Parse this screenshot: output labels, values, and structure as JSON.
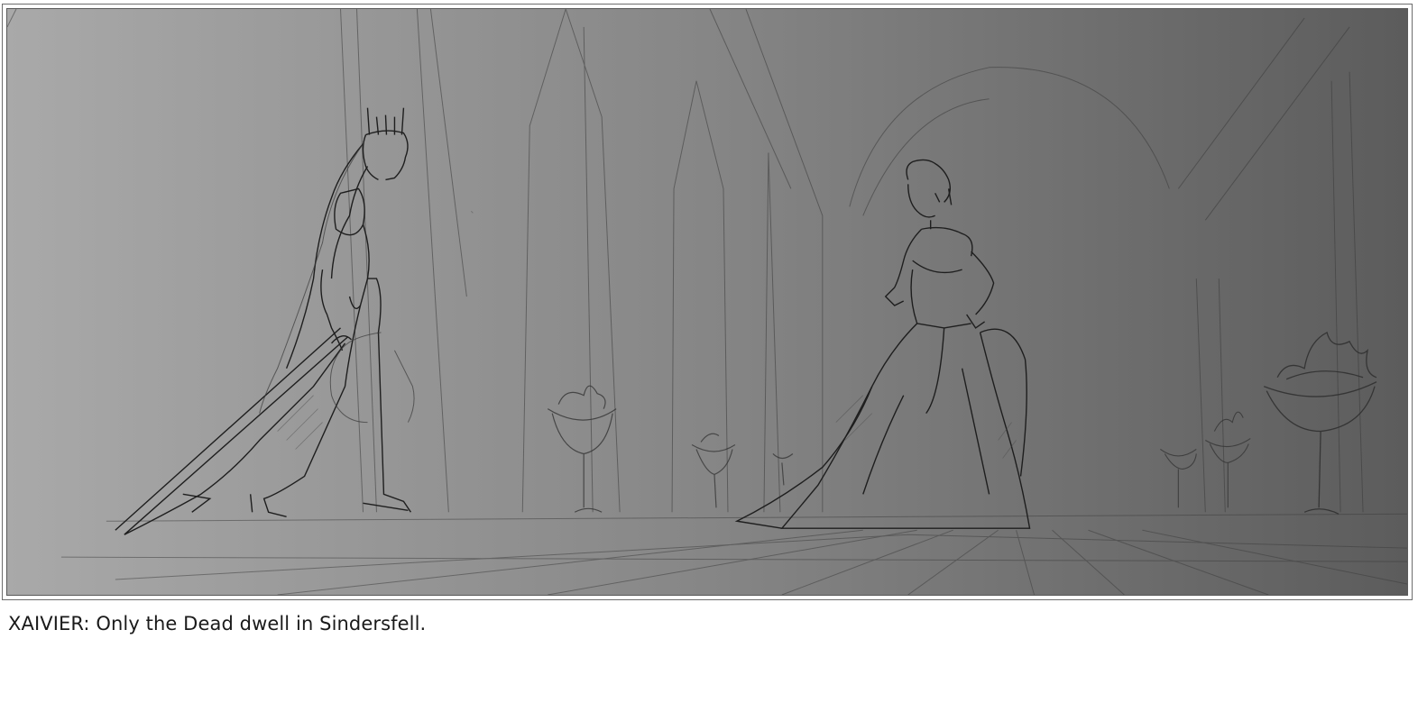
{
  "caption": "XAIVIER: Only the Dead dwell in Sindersfell.",
  "panel": {
    "gradient_left": "#a9a9a9",
    "gradient_right": "#5c5c5c",
    "line_color": "#2e2e2e"
  }
}
